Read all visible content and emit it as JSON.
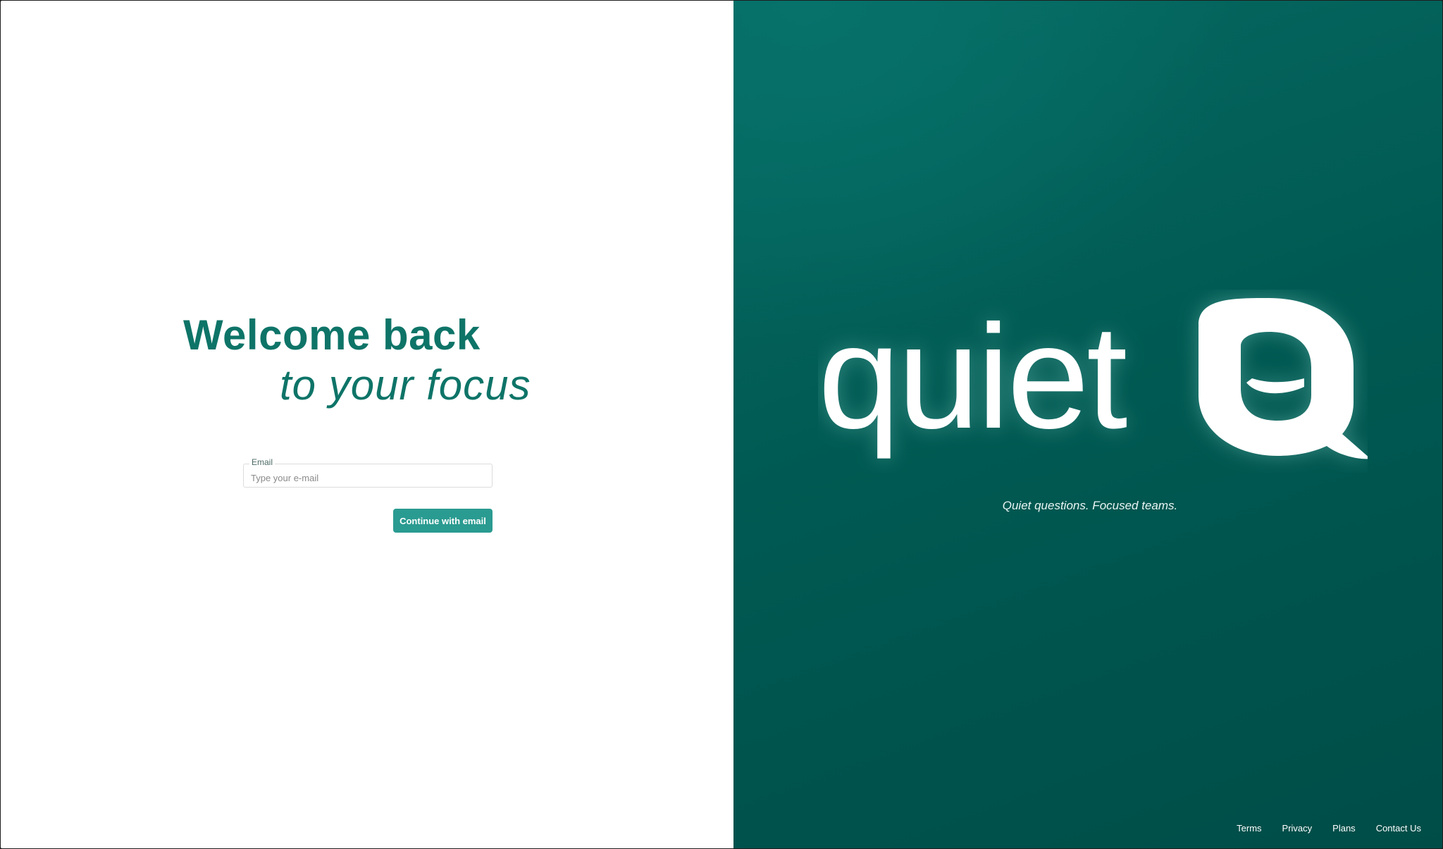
{
  "login": {
    "headline_line1": "Welcome back",
    "headline_line2": "to your focus",
    "email_label": "Email",
    "email_placeholder": "Type your e-mail",
    "email_value": "",
    "continue_label": "Continue with email"
  },
  "brand": {
    "logo_text": "quiet",
    "logo_icon": "speech-bubble-q-logo",
    "tagline": "Quiet questions. Focused teams.",
    "colors": {
      "primary": "#0e7468",
      "button": "#2a9b91",
      "panel": "#005a53"
    }
  },
  "footer": {
    "links": [
      "Terms",
      "Privacy",
      "Plans",
      "Contact Us"
    ]
  }
}
